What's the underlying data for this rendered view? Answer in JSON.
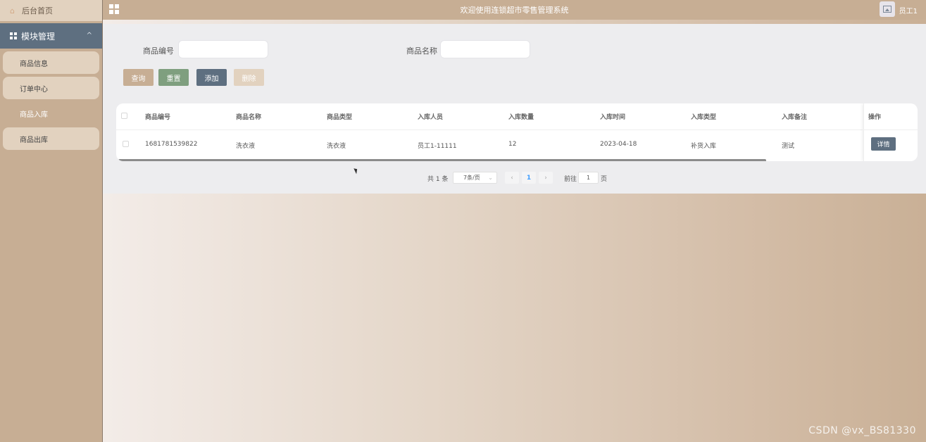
{
  "sidebar": {
    "home_label": "后台首页",
    "module_label": "模块管理",
    "items": [
      {
        "label": "商品信息",
        "active": false
      },
      {
        "label": "订单中心",
        "active": false
      },
      {
        "label": "商品入库",
        "active": true
      },
      {
        "label": "商品出库",
        "active": false
      }
    ]
  },
  "header": {
    "title": "欢迎使用连锁超市零售管理系统",
    "user": "员工1"
  },
  "search": {
    "code_label": "商品编号",
    "code_value": "",
    "name_label": "商品名称",
    "name_value": ""
  },
  "buttons": {
    "query": "查询",
    "reset": "重置",
    "add": "添加",
    "delete": "删除"
  },
  "table": {
    "columns": [
      "商品编号",
      "商品名称",
      "商品类型",
      "入库人员",
      "入库数量",
      "入库时间",
      "入库类型",
      "入库备注"
    ],
    "op_header": "操作",
    "rows": [
      {
        "cells": [
          "1681781539822",
          "洗衣液",
          "洗衣液",
          "员工1-11111",
          "12",
          "2023-04-18",
          "补货入库",
          "测试"
        ],
        "action": "详情"
      }
    ]
  },
  "pagination": {
    "total": "共 1 条",
    "page_size": "7条/页",
    "current": "1",
    "goto_label": "前往",
    "goto_value": "1",
    "page_suffix": "页"
  },
  "watermark": "CSDN @vx_BS81330",
  "colors": {
    "sidebar": "#c7ae94",
    "module_header": "#5e6f80",
    "query_button": "#c7ae94",
    "reset_button": "#7f9f7f",
    "add_button": "#5e6f80",
    "delete_button": "#e2d2bf"
  }
}
